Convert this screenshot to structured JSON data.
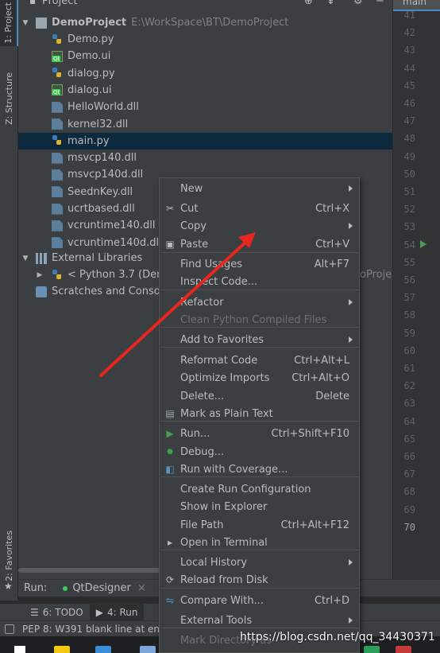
{
  "left_strip": {
    "project_tab": "1: Project",
    "structure_tab": "Z: Structure",
    "favorites_tab": "2: Favorites"
  },
  "project_panel": {
    "title": "Project",
    "root": {
      "name": "DemoProject",
      "path": "E:\\WorkSpace\\BT\\DemoProject"
    },
    "files": [
      {
        "name": "Demo.py",
        "icon": "python-file-icon"
      },
      {
        "name": "Demo.ui",
        "icon": "qt-ui-file-icon"
      },
      {
        "name": "dialog.py",
        "icon": "python-file-icon"
      },
      {
        "name": "dialog.ui",
        "icon": "qt-ui-file-icon"
      },
      {
        "name": "HelloWorld.dll",
        "icon": "dll-file-icon"
      },
      {
        "name": "kernel32.dll",
        "icon": "dll-file-icon"
      },
      {
        "name": "main.py",
        "icon": "python-file-icon",
        "selected": true
      },
      {
        "name": "msvcp140.dll",
        "icon": "dll-file-icon"
      },
      {
        "name": "msvcp140d.dll",
        "icon": "dll-file-icon"
      },
      {
        "name": "SeednKey.dll",
        "icon": "dll-file-icon"
      },
      {
        "name": "ucrtbased.dll",
        "icon": "dll-file-icon"
      },
      {
        "name": "vcruntime140.dll",
        "icon": "dll-file-icon"
      },
      {
        "name": "vcruntime140d.dll",
        "icon": "dll-file-icon"
      }
    ],
    "external_libraries": "External Libraries",
    "python_sdk": "< Python 3.7 (Dem",
    "python_sdk_tail": "oProje",
    "scratches": "Scratches and Console"
  },
  "editor": {
    "tab_label": "main",
    "line_numbers": [
      "41",
      "42",
      "43",
      "44",
      "45",
      "46",
      "47",
      "48",
      "49",
      "50",
      "51",
      "52",
      "53",
      "54",
      "55",
      "56",
      "57",
      "58",
      "59",
      "60",
      "61",
      "62",
      "63",
      "64",
      "65",
      "66",
      "67",
      "68",
      "69",
      "70"
    ],
    "current_line": "70"
  },
  "context_menu": {
    "items": [
      {
        "label": "New",
        "submenu": true
      },
      {
        "label": "Cut",
        "shortcut": "Ctrl+X",
        "icon": "scissors-icon"
      },
      {
        "label": "Copy",
        "submenu": true
      },
      {
        "label": "Paste",
        "shortcut": "Ctrl+V",
        "icon": "clipboard-icon"
      },
      {
        "label": "Find Usages",
        "shortcut": "Alt+F7"
      },
      {
        "label": "Inspect Code..."
      },
      {
        "label": "Refactor",
        "submenu": true
      },
      {
        "label": "Clean Python Compiled Files",
        "disabled": true
      },
      {
        "label": "Add to Favorites",
        "submenu": true
      },
      {
        "label": "Reformat Code",
        "shortcut": "Ctrl+Alt+L"
      },
      {
        "label": "Optimize Imports",
        "shortcut": "Ctrl+Alt+O"
      },
      {
        "label": "Delete...",
        "shortcut": "Delete"
      },
      {
        "label": "Mark as Plain Text",
        "icon": "plain-text-icon"
      },
      {
        "label": "Run...",
        "shortcut": "Ctrl+Shift+F10",
        "icon": "run-icon"
      },
      {
        "label": "Debug...",
        "icon": "debug-icon"
      },
      {
        "label": "Run with Coverage...",
        "icon": "coverage-icon"
      },
      {
        "label": "Create Run Configuration"
      },
      {
        "label": "Show in Explorer"
      },
      {
        "label": "File Path",
        "shortcut": "Ctrl+Alt+F12"
      },
      {
        "label": "Open in Terminal",
        "icon": "terminal-icon"
      },
      {
        "label": "Local History",
        "submenu": true
      },
      {
        "label": "Reload from Disk",
        "icon": "reload-icon"
      },
      {
        "label": "Compare With...",
        "shortcut": "Ctrl+D",
        "icon": "compare-icon"
      },
      {
        "label": "External Tools",
        "submenu": true
      },
      {
        "label": "Mark Directory as",
        "disabled": true
      }
    ]
  },
  "run_bar": {
    "label": "Run:",
    "config": "QtDesigner",
    "close": "×"
  },
  "bottom_tabs": [
    {
      "label": "6: TODO"
    },
    {
      "label": "4: Run",
      "active": true
    }
  ],
  "status_bar": {
    "message": "PEP 8: W391 blank line at en"
  },
  "watermark": "https://blog.csdn.net/qq_34430371",
  "colors": {
    "annotation_arrow": "#e8261f",
    "selection": "#0d293e",
    "run_green": "#499c54"
  }
}
